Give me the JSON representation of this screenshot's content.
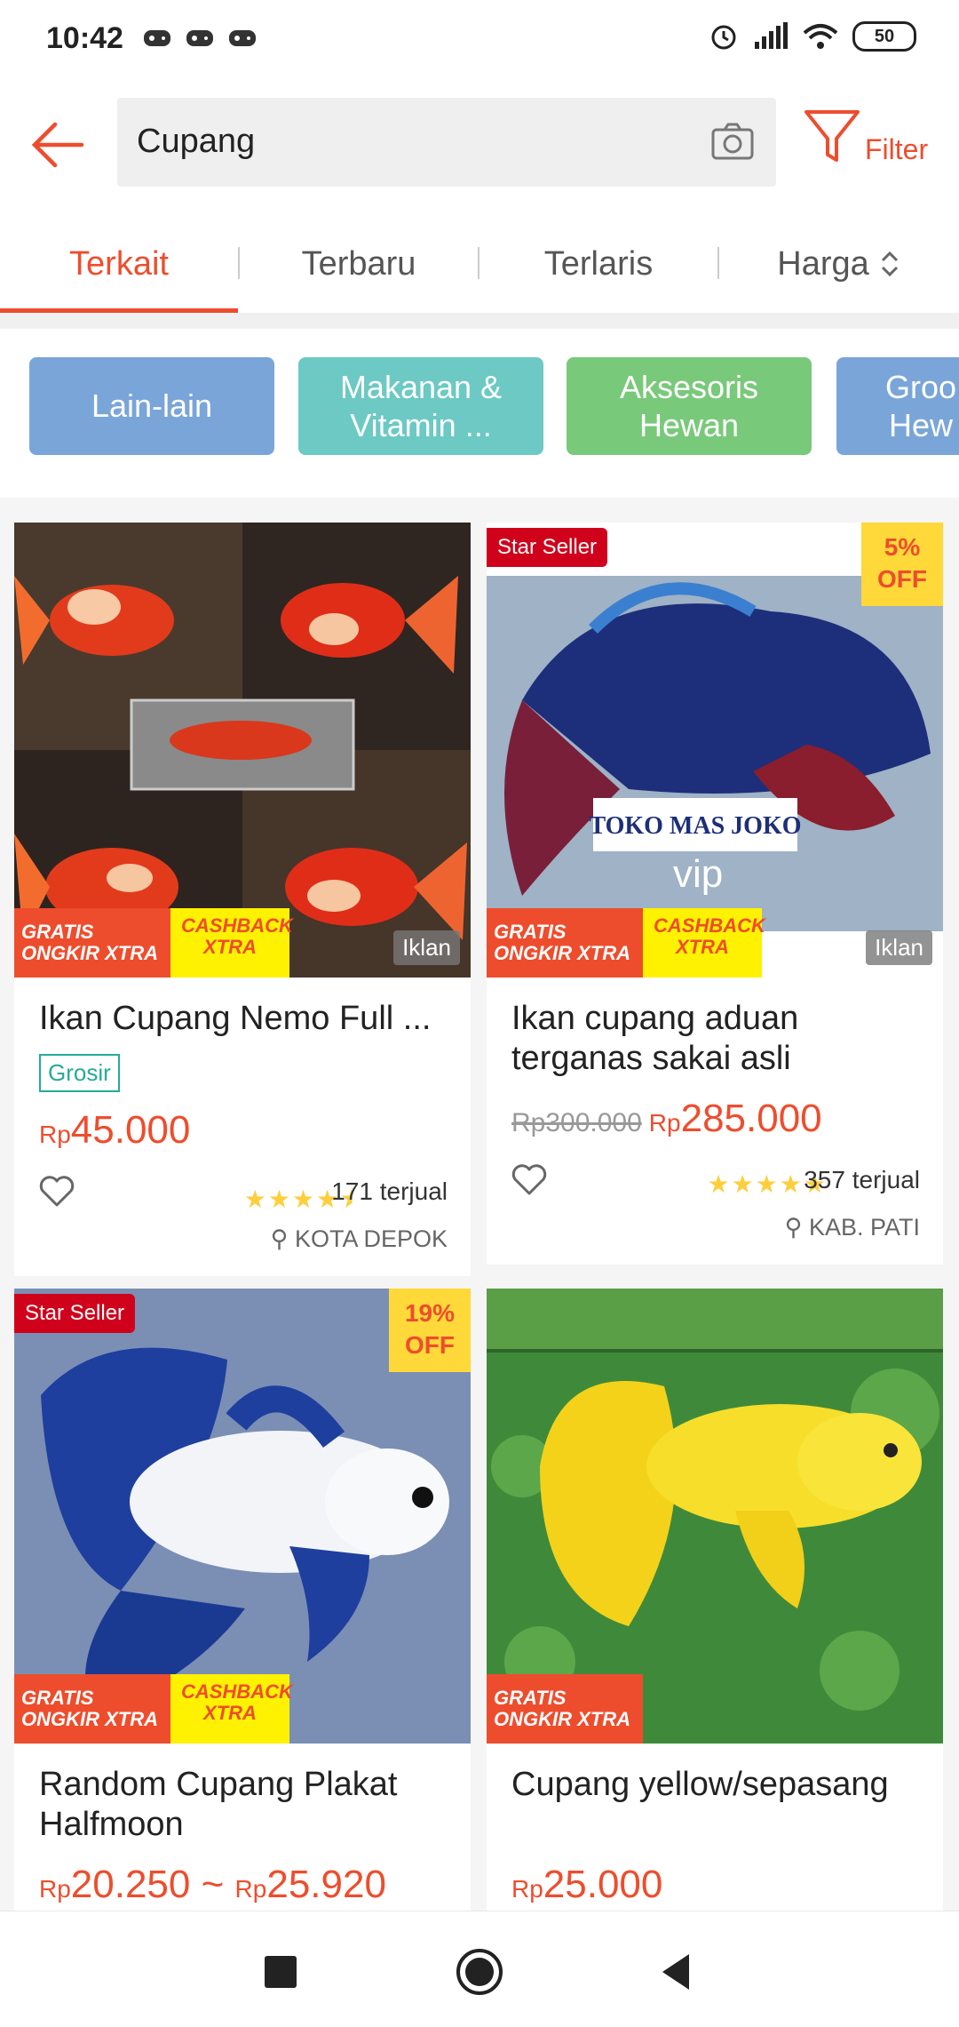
{
  "status": {
    "time": "10:42",
    "battery": "50"
  },
  "search": {
    "query": "Cupang",
    "filter_label": "Filter"
  },
  "tabs": [
    "Terkait",
    "Terbaru",
    "Terlaris",
    "Harga"
  ],
  "categories": [
    {
      "label": "Lain-lain",
      "color": "#7aa5d8"
    },
    {
      "label": "Makanan & Vitamin ...",
      "color": "#6cc9c3"
    },
    {
      "label": "Aksesoris Hewan",
      "color": "#79c97a"
    },
    {
      "label": "Groo Hew",
      "color": "#7aa5d8"
    }
  ],
  "products": [
    {
      "title": "Ikan Cupang Nemo Full ...",
      "badge_grosir": "Grosir",
      "currency": "Rp",
      "price": "45.000",
      "rating": 4.5,
      "sold": "171 terjual",
      "location": "KOTA DEPOK",
      "ad_label": "Iklan",
      "promo_gratis": "GRATIS ONGKIR XTRA",
      "promo_cashback": "CASHBACK XTRA"
    },
    {
      "title": "Ikan cupang aduan terganas sakai asli",
      "star_seller": "Star Seller",
      "discount": "5% OFF",
      "old_price": "Rp300.000",
      "currency": "Rp",
      "price": "285.000",
      "rating": 5,
      "sold": "357 terjual",
      "location": "KAB. PATI",
      "ad_label": "Iklan",
      "image_text": "TOKO MAS JOKO",
      "image_text2": "vip",
      "promo_gratis": "GRATIS ONGKIR XTRA",
      "promo_cashback": "CASHBACK XTRA"
    },
    {
      "title": "Random Cupang Plakat Halfmoon",
      "star_seller": "Star Seller",
      "discount": "19% OFF",
      "currency": "Rp",
      "price": "20.250",
      "price_sep": "~",
      "price_max": "25.920",
      "promo_gratis": "GRATIS ONGKIR XTRA",
      "promo_cashback": "CASHBACK XTRA"
    },
    {
      "title": "Cupang yellow/sepasang",
      "currency": "Rp",
      "price": "25.000",
      "promo_gratis": "GRATIS ONGKIR XTRA"
    }
  ]
}
